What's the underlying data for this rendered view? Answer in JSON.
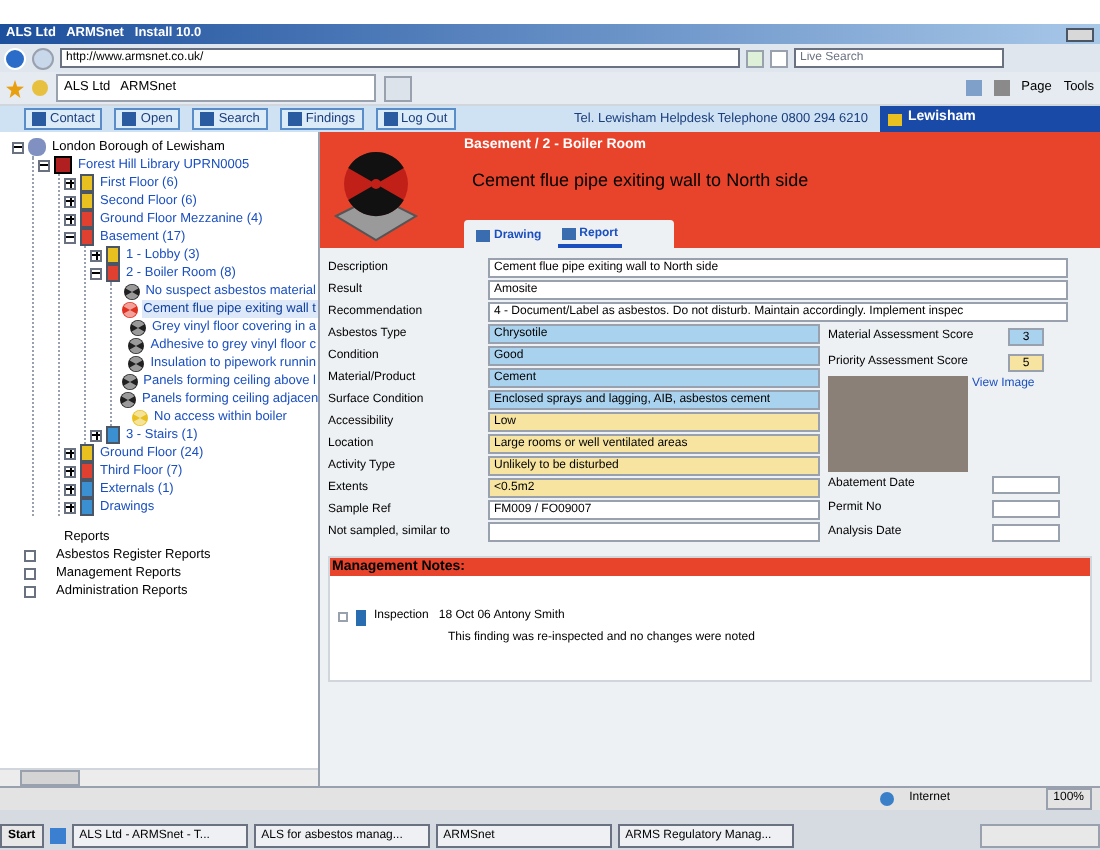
{
  "browser": {
    "title": "ALS Ltd   ARMSnet   Install 10.0",
    "address": "http://www.armsnet.co.uk/",
    "search_placeholder": "Live Search",
    "favorite_tab": "ALS Ltd   ARMSnet",
    "tools": [
      "Page",
      "Tools"
    ]
  },
  "toolbar": {
    "buttons": [
      "Contact",
      "Open",
      "Search",
      "Findings",
      "Log Out"
    ],
    "helpdesk": "Tel. Lewisham Helpdesk Telephone 0800 294 6210",
    "brand": "Lewisham"
  },
  "tree": [
    {
      "label": "London Borough of Lewisham",
      "kind": "root",
      "expanded": true,
      "selected": false,
      "children": [
        {
          "label": "Forest Hill Library UPRN0005",
          "kind": "site",
          "expanded": true,
          "selected": false,
          "children": [
            {
              "label": "First Floor (6)",
              "kind": "floor",
              "color": "#e8c020",
              "expanded": false,
              "selected": false
            },
            {
              "label": "Second Floor (6)",
              "kind": "floor",
              "color": "#e8c020",
              "expanded": false,
              "selected": false
            },
            {
              "label": "Ground Floor Mezzanine (4)",
              "kind": "floor",
              "color": "#e04030",
              "expanded": false,
              "selected": false
            },
            {
              "label": "Basement (17)",
              "kind": "floor",
              "color": "#e04030",
              "expanded": true,
              "selected": false,
              "children": [
                {
                  "label": "1 - Lobby (3)",
                  "kind": "floor",
                  "color": "#e8c020",
                  "expanded": false,
                  "selected": false
                },
                {
                  "label": "2 - Boiler Room (8)",
                  "kind": "floor",
                  "color": "#e04030",
                  "expanded": true,
                  "selected": false,
                  "children": [
                    {
                      "label": "No suspect asbestos material",
                      "kind": "finding",
                      "color": "#202020",
                      "selected": false
                    },
                    {
                      "label": "Cement flue pipe exiting wall t",
                      "kind": "finding",
                      "color": "#e03020",
                      "selected": true
                    },
                    {
                      "label": "Grey vinyl floor covering in a",
                      "kind": "finding",
                      "color": "#202020",
                      "selected": false
                    },
                    {
                      "label": "Adhesive to grey vinyl floor c",
                      "kind": "finding",
                      "color": "#202020",
                      "selected": false
                    },
                    {
                      "label": "Insulation to pipework runnin",
                      "kind": "finding",
                      "color": "#202020",
                      "selected": false
                    },
                    {
                      "label": "Panels forming ceiling above l",
                      "kind": "finding",
                      "color": "#202020",
                      "selected": false
                    },
                    {
                      "label": "Panels forming ceiling adjacen",
                      "kind": "finding",
                      "color": "#202020",
                      "selected": false
                    },
                    {
                      "label": "No access within boiler",
                      "kind": "finding",
                      "color": "#e8c020",
                      "selected": false
                    }
                  ]
                },
                {
                  "label": "3 - Stairs (1)",
                  "kind": "floor",
                  "color": "#3a90d0",
                  "expanded": false,
                  "selected": false
                }
              ]
            },
            {
              "label": "Ground Floor (24)",
              "kind": "floor",
              "color": "#e8c020",
              "expanded": false,
              "selected": false
            },
            {
              "label": "Third Floor (7)",
              "kind": "floor",
              "color": "#e04030",
              "expanded": false,
              "selected": false
            },
            {
              "label": "Externals (1)",
              "kind": "floor",
              "color": "#3a90d0",
              "expanded": false,
              "selected": false
            },
            {
              "label": "Drawings",
              "kind": "floor",
              "color": "#3a90d0",
              "expanded": false,
              "selected": false
            }
          ]
        }
      ]
    }
  ],
  "reports": {
    "label": "Reports",
    "items": [
      "Asbestos Register Reports",
      "Management Reports",
      "Administration Reports"
    ]
  },
  "detail": {
    "breadcrumb": "Basement / 2 - Boiler Room",
    "title": "Cement flue pipe exiting wall to North side",
    "tabs": [
      {
        "label": "Drawing",
        "selected": false
      },
      {
        "label": "Report",
        "selected": true
      }
    ],
    "fields": [
      {
        "label": "Description",
        "value": "Cement flue pipe exiting wall to North side",
        "color": "#ffffff",
        "wide": true
      },
      {
        "label": "Result",
        "value": "Amosite",
        "color": "#ffffff",
        "wide": true
      },
      {
        "label": "Recommendation",
        "value": "4 - Document/Label as asbestos. Do not disturb. Maintain accordingly. Implement inspec",
        "color": "#ffffff",
        "wide": true
      },
      {
        "label": "Asbestos Type",
        "value": "Chrysotile",
        "color": "#a9d2ee",
        "wide": false
      },
      {
        "label": "Condition",
        "value": "Good",
        "color": "#a9d2ee",
        "wide": false
      },
      {
        "label": "Material/Product",
        "value": "Cement",
        "color": "#a9d2ee",
        "wide": false
      },
      {
        "label": "Surface Condition",
        "value": "Enclosed sprays and lagging, AIB, asbestos cement",
        "color": "#a9d2ee",
        "wide": false
      },
      {
        "label": "Accessibility",
        "value": "Low",
        "color": "#f6e4a0",
        "wide": false
      },
      {
        "label": "Location",
        "value": "Large rooms or well ventilated areas",
        "color": "#f6e4a0",
        "wide": false
      },
      {
        "label": "Activity Type",
        "value": "Unlikely to be disturbed",
        "color": "#f6e4a0",
        "wide": false
      },
      {
        "label": "Extents",
        "value": "<0.5m2",
        "color": "#f6e4a0",
        "wide": false
      },
      {
        "label": "Sample Ref",
        "value": "FM009 / FO09007",
        "color": "#ffffff",
        "wide": false
      },
      {
        "label": "Not sampled, similar to",
        "color": "#ffffff",
        "wide": false
      }
    ],
    "scores": [
      {
        "label": "Material Assessment Score",
        "value": "3",
        "color": "#a9d2ee"
      },
      {
        "label": "Priority Assessment Score",
        "value": "5",
        "color": "#f6e4a0"
      }
    ],
    "view_image": "View Image",
    "dates": [
      "Abatement Date",
      "Permit No",
      "Analysis Date"
    ],
    "notes": {
      "title": "Management Notes:",
      "entry": "Inspection   18 Oct 06 Antony Smith",
      "text": "This finding was re-inspected and no changes were noted"
    }
  },
  "status": {
    "zone": "Internet",
    "zoom": "100%"
  },
  "taskbar": {
    "start": "Start",
    "items": [
      "ALS Ltd - ARMSnet - T...",
      "ALS for asbestos manag...",
      "ARMSnet",
      "ARMS Regulatory Manag..."
    ]
  }
}
